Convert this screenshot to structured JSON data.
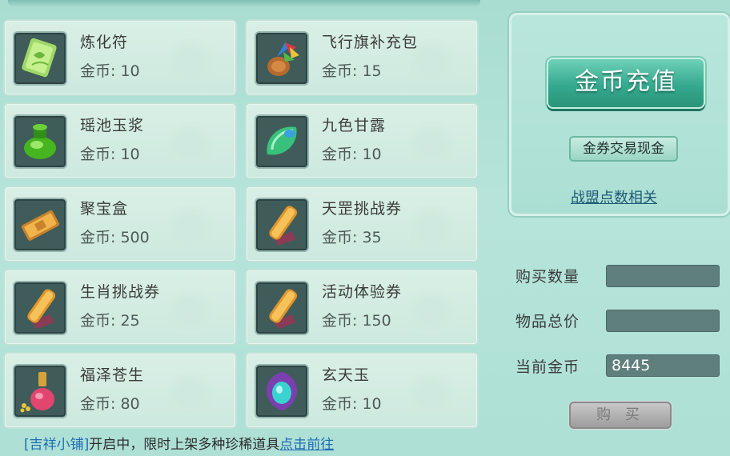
{
  "items": [
    {
      "name": "炼化符",
      "price": "金币: 10",
      "icon": "talisman-icon"
    },
    {
      "name": "飞行旗补充包",
      "price": "金币: 15",
      "icon": "flag-bag-icon"
    },
    {
      "name": "瑶池玉浆",
      "price": "金币: 10",
      "icon": "green-jar-icon"
    },
    {
      "name": "九色甘露",
      "price": "金币: 10",
      "icon": "jade-leaf-icon"
    },
    {
      "name": "聚宝盒",
      "price": "金币: 500",
      "icon": "treasure-box-icon"
    },
    {
      "name": "天罡挑战券",
      "price": "金币: 35",
      "icon": "scroll-icon"
    },
    {
      "name": "生肖挑战券",
      "price": "金币: 25",
      "icon": "scroll-icon"
    },
    {
      "name": "活动体验券",
      "price": "金币: 150",
      "icon": "scroll-icon"
    },
    {
      "name": "福泽苍生",
      "price": "金币: 80",
      "icon": "potion-bottle-icon"
    },
    {
      "name": "玄天玉",
      "price": "金币: 10",
      "icon": "mystic-jade-icon"
    }
  ],
  "panel": {
    "recharge_label": "金币充值",
    "trade_label": "金券交易现金",
    "alliance_label": "战盟点数相关"
  },
  "purchase": {
    "qty_label": "购买数量",
    "qty_value": "",
    "total_label": "物品总价",
    "total_value": "",
    "gold_label": "当前金币",
    "gold_value": "8445",
    "buy_label": "购 买"
  },
  "notice": {
    "shop": "[吉祥小铺]",
    "text": "开启中，限时上架多种珍稀道具",
    "link": "点击前往"
  },
  "colors": {
    "background": "#b0e1d7",
    "accent": "#35a98e",
    "link": "#1f6db2"
  }
}
